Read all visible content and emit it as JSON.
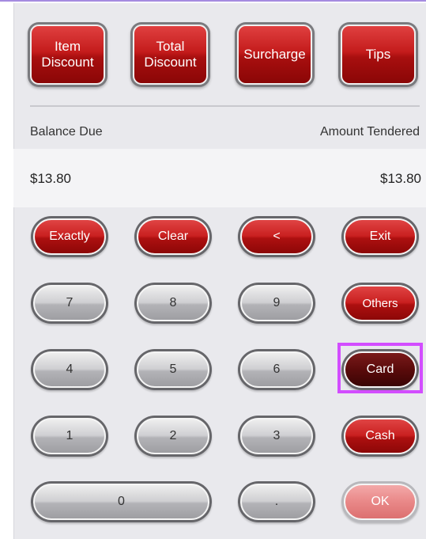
{
  "top_buttons": [
    "Item\nDiscount",
    "Total\nDiscount",
    "Surcharge",
    "Tips"
  ],
  "balance_due_label": "Balance Due",
  "amount_tendered_label": "Amount Tendered",
  "balance_due_value": "$13.80",
  "amount_tendered_value": "$13.80",
  "keys": {
    "exactly": "Exactly",
    "clear": "Clear",
    "back": "<",
    "exit": "Exit",
    "seven": "7",
    "eight": "8",
    "nine": "9",
    "others": "Others",
    "four": "4",
    "five": "5",
    "six": "6",
    "card": "Card",
    "one": "1",
    "two": "2",
    "three": "3",
    "cash": "Cash",
    "zero": "0",
    "dot": ".",
    "ok": "OK"
  },
  "colors": {
    "accent_red": "#c41c1c",
    "selected_highlight": "#d24dff"
  }
}
